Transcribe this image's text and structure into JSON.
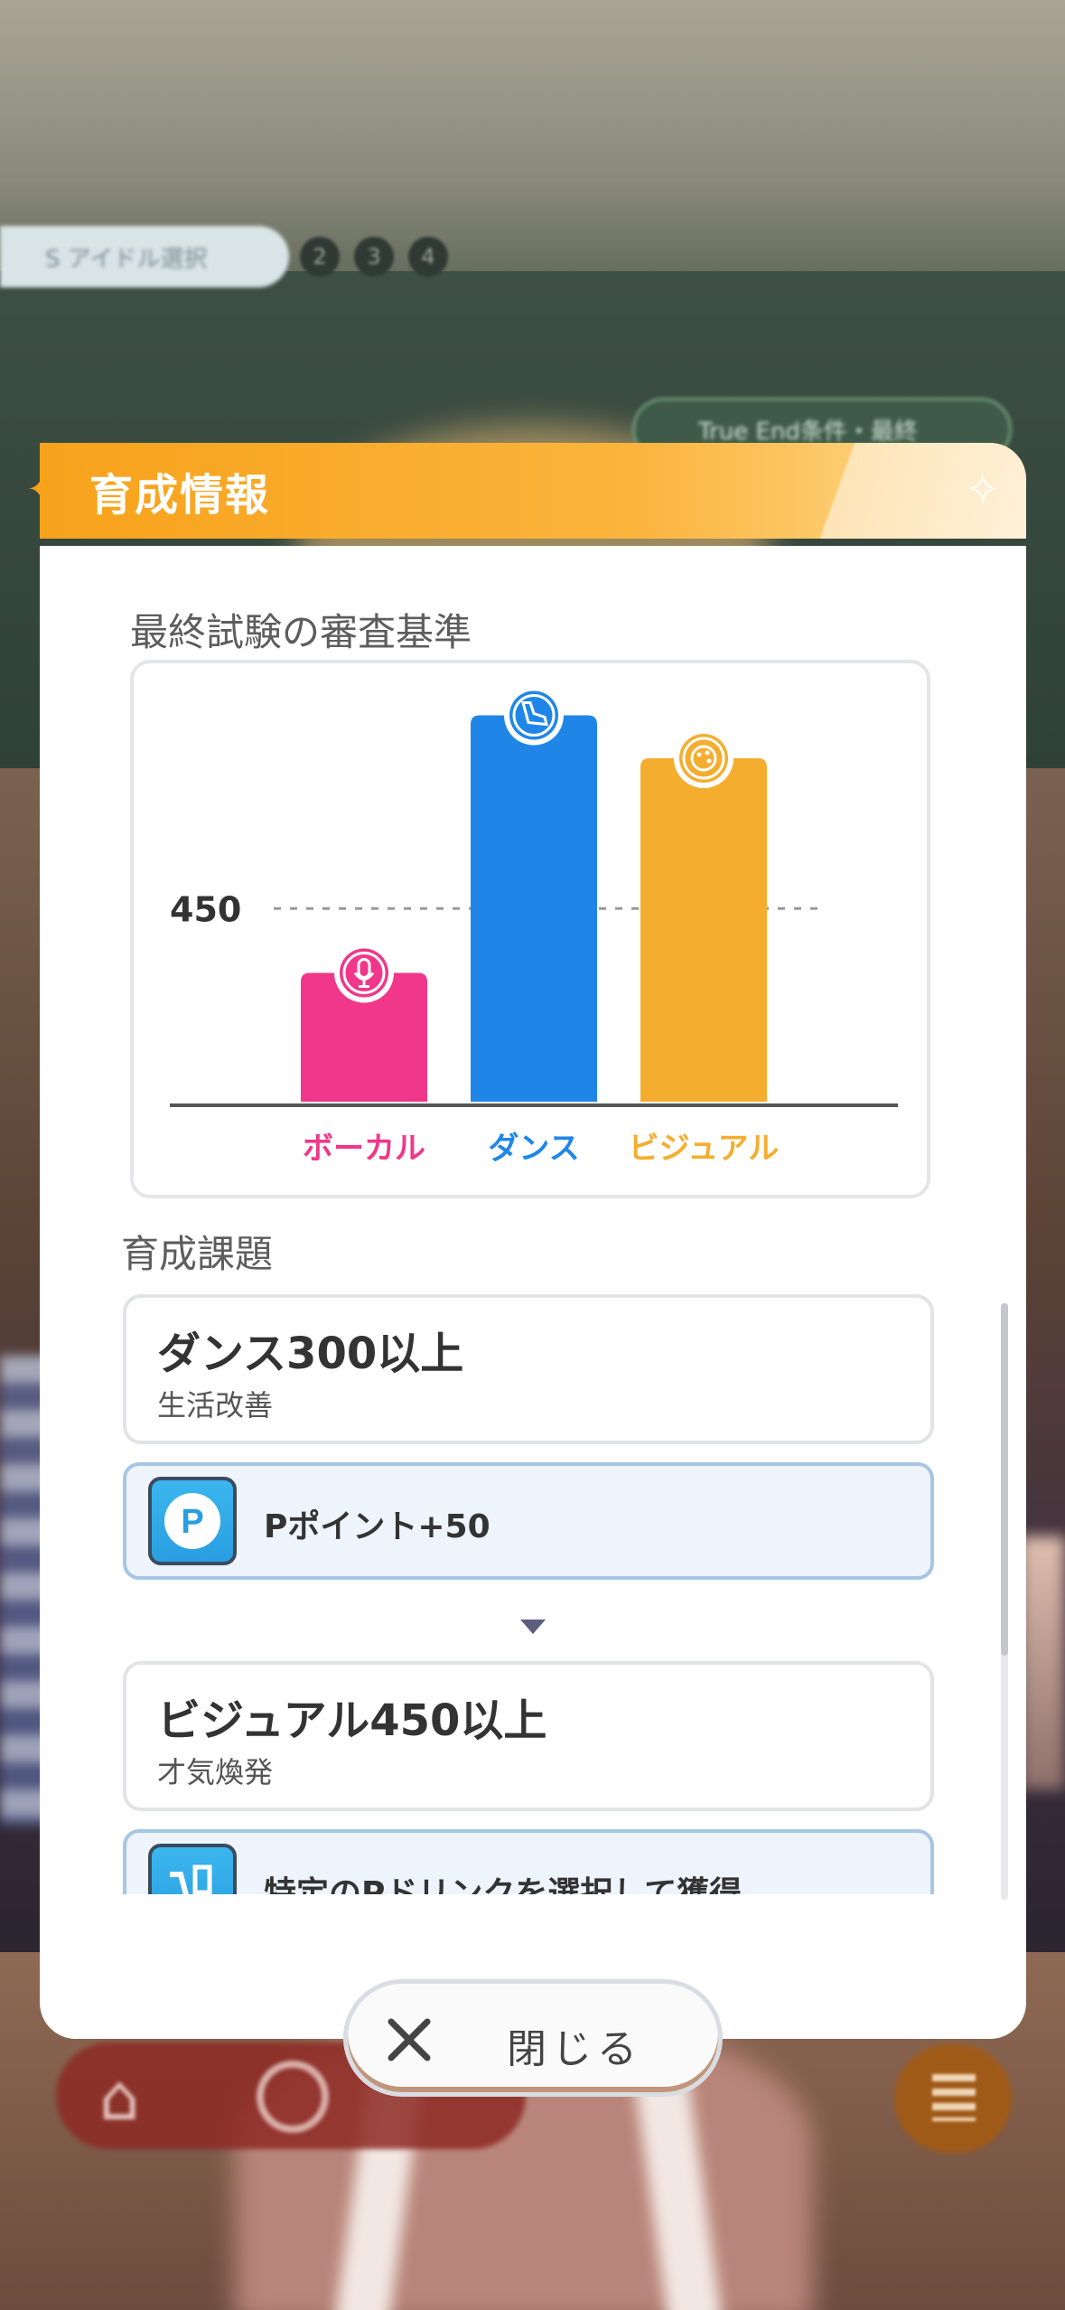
{
  "background": {
    "progress_label": "S アイドル選択",
    "steps": [
      "2",
      "3",
      "4"
    ],
    "true_end_badge": "True End条件・最終"
  },
  "modal": {
    "title": "育成情報",
    "colors": {
      "header": "#f7a21b",
      "vocal": "#f0378a",
      "dance": "#1f86e8",
      "visual": "#f5ad2f"
    },
    "criteria_title": "最終試験の審査基準",
    "tasks_title": "育成課題",
    "tasks": [
      {
        "name": "ダンス300以上",
        "sub": "生活改善",
        "reward_label": "Pポイント+50",
        "reward_icon": "p-point-icon"
      },
      {
        "name": "ビジュアル450以上",
        "sub": "才気煥発",
        "reward_label": "特定のPドリンクを選択して獲得",
        "reward_icon": "drink-cart-icon"
      }
    ],
    "close_label": "閉じる"
  },
  "chart_data": {
    "type": "bar",
    "categories": [
      "ボーカル",
      "ダンス",
      "ビジュアル"
    ],
    "values": [
      300,
      900,
      800
    ],
    "reference_line": 450,
    "reference_label": "450",
    "icons": [
      "microphone-icon",
      "shoe-icon",
      "palette-icon"
    ],
    "colors": [
      "#f0378a",
      "#1f86e8",
      "#f5ad2f"
    ],
    "ylim": [
      0,
      1000
    ]
  },
  "bottom_nav": {
    "icons": [
      "home-icon",
      "calendar-icon",
      "menu-icon"
    ]
  }
}
